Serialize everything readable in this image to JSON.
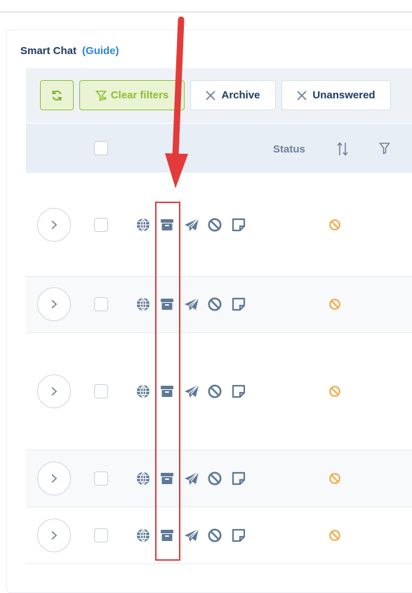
{
  "app": {
    "title": "Smart Chat",
    "guide_link": "(Guide)"
  },
  "toolbar": {
    "refresh_icon": "refresh-icon",
    "clear_filters_label": "Clear filters",
    "chips": [
      {
        "label": "Archive",
        "icon": "close-icon"
      },
      {
        "label": "Unanswered",
        "icon": "close-icon"
      }
    ]
  },
  "table": {
    "header": {
      "status_label": "Status"
    },
    "row_actions": [
      "globe-icon",
      "archive-icon",
      "send-icon",
      "block-icon",
      "note-icon"
    ],
    "rows": [
      {
        "status_icon": "block-icon"
      },
      {
        "status_icon": "block-icon"
      },
      {
        "status_icon": "block-icon"
      },
      {
        "status_icon": "block-icon"
      },
      {
        "status_icon": "block-icon"
      }
    ]
  },
  "colors": {
    "accent_green": "#8dbf2f",
    "text_navy": "#1d3b63",
    "link_blue": "#2a86d6",
    "icon_slate": "#5f7896",
    "status_orange": "#f3a53b",
    "annotation_red": "#e33b3b"
  }
}
